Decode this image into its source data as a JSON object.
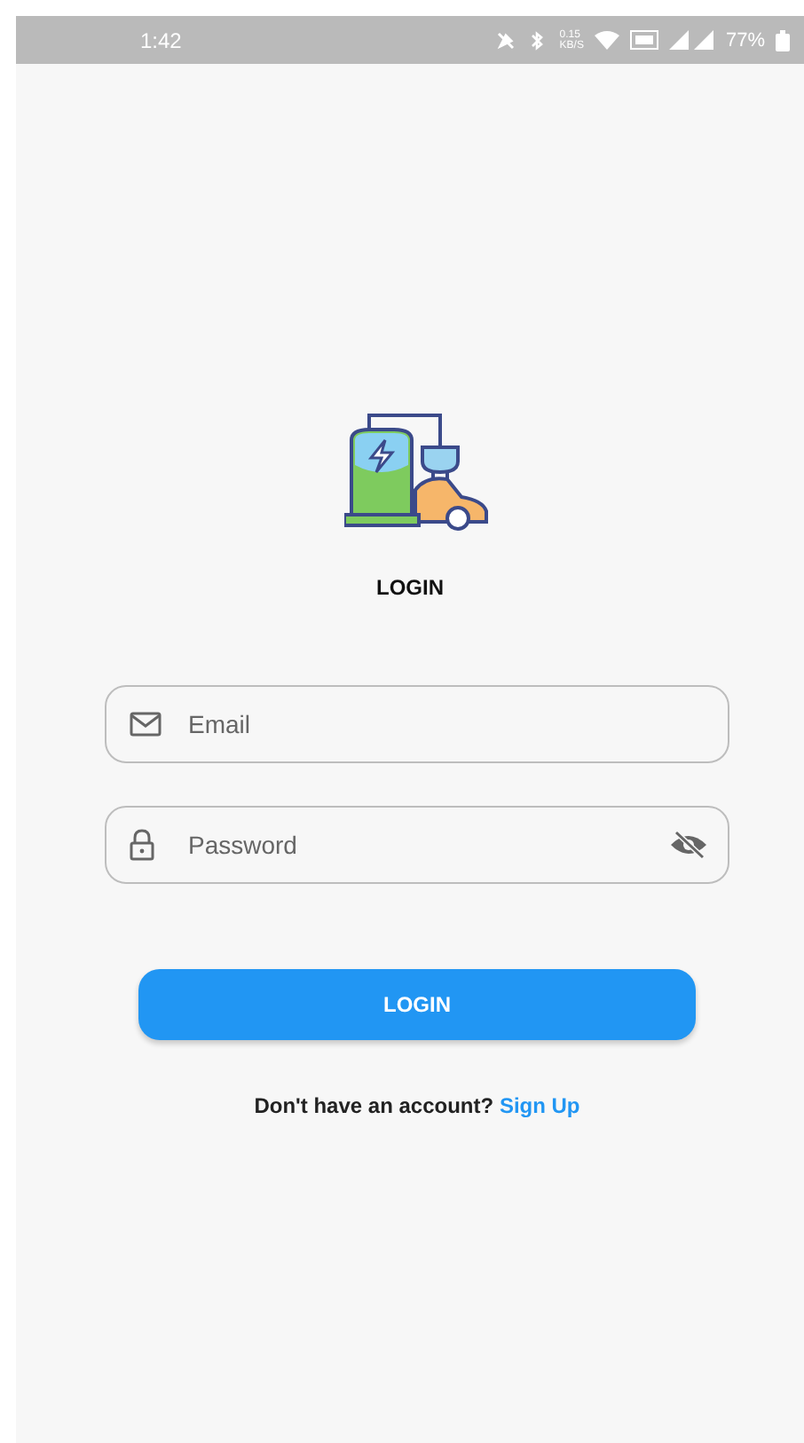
{
  "status_bar": {
    "time": "1:42",
    "speed_value": "0.15",
    "speed_unit": "KB/S",
    "battery": "77%"
  },
  "title": "LOGIN",
  "fields": [
    {
      "kind": "email",
      "placeholder": "Email"
    },
    {
      "kind": "password",
      "placeholder": "Password",
      "obscured": true
    }
  ],
  "login_button": "LOGIN",
  "signup_prompt": {
    "text": "Don't have an account?",
    "link": "Sign Up"
  }
}
